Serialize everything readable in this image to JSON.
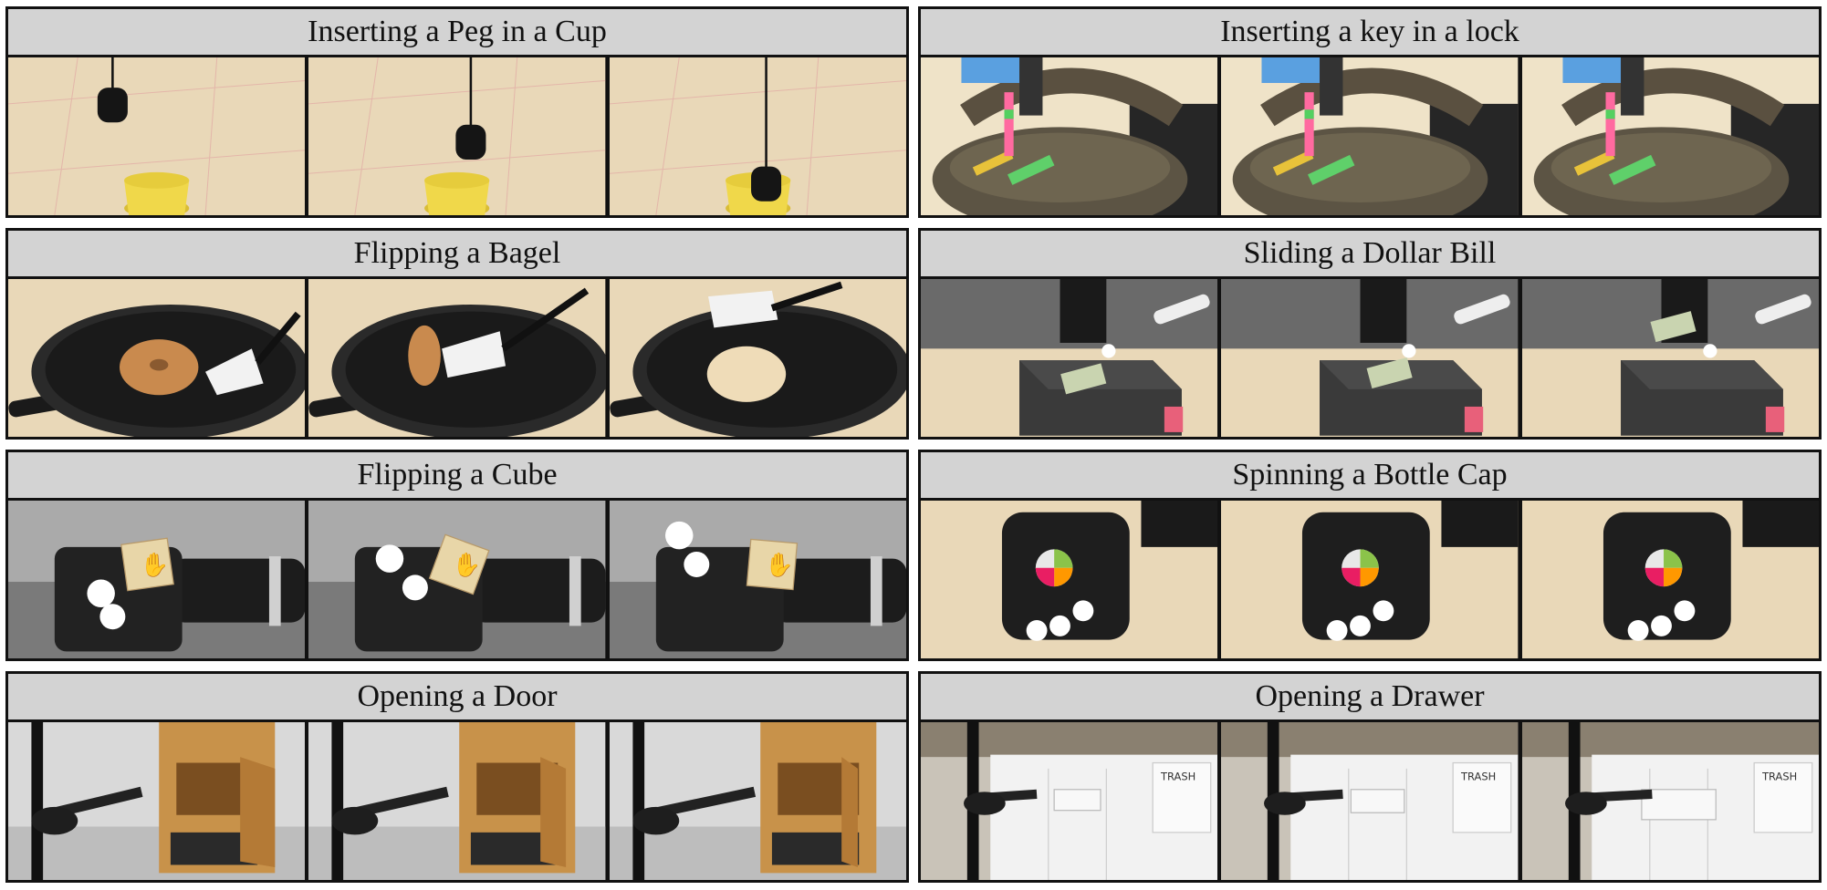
{
  "panels": [
    {
      "title": "Inserting a Peg in a Cup",
      "scene": "peg"
    },
    {
      "title": "Inserting a key in a lock",
      "scene": "lock"
    },
    {
      "title": "Flipping a Bagel",
      "scene": "bagel"
    },
    {
      "title": "Sliding a Dollar Bill",
      "scene": "dollar"
    },
    {
      "title": "Flipping a Cube",
      "scene": "cube"
    },
    {
      "title": "Spinning a Bottle Cap",
      "scene": "cap"
    },
    {
      "title": "Opening a Door",
      "scene": "door"
    },
    {
      "title": "Opening a Drawer",
      "scene": "drawer"
    }
  ],
  "frames_per_panel": 3,
  "colors": {
    "header_bg": "#d3d3d3",
    "border": "#111111",
    "table_wood": "#e9d8b8",
    "cup_yellow": "#f0d84a",
    "pan_black": "#1a1a1a",
    "bagel": "#c98a4e",
    "foam_block": "#3a3a3a",
    "cube_wood": "#e8d6a8",
    "cabinet_wood": "#c8924a",
    "cabinet_white": "#f2f2f2"
  }
}
